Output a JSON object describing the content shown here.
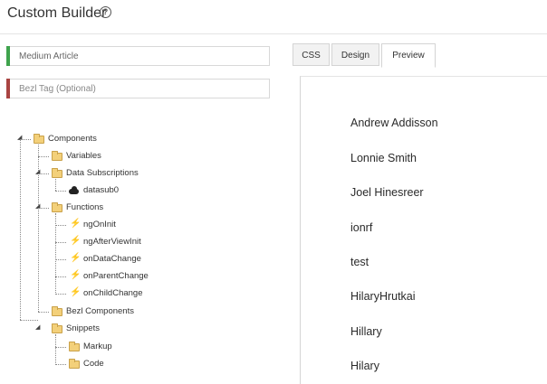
{
  "header": {
    "title": "Custom Builder",
    "help_icon": "?"
  },
  "fields": {
    "name_value": "Medium Article",
    "tag_placeholder": "Bezl Tag (Optional)"
  },
  "tabs": [
    {
      "label": "CSS",
      "active": false
    },
    {
      "label": "Design",
      "active": false
    },
    {
      "label": "Preview",
      "active": true
    }
  ],
  "tree": {
    "root": "Components",
    "variables": "Variables",
    "data_subscriptions": "Data Subscriptions",
    "datasub": "datasub0",
    "functions": "Functions",
    "function_items": [
      "ngOnInit",
      "ngAfterViewInit",
      "onDataChange",
      "onParentChange",
      "onChildChange"
    ],
    "bezl_components": "Bezl Components",
    "snippets": "Snippets",
    "markup": "Markup",
    "code": "Code"
  },
  "preview": {
    "items": [
      "Andrew Addisson",
      "Lonnie Smith",
      "Joel Hinesreer",
      "ionrf",
      "test",
      "HilaryHrutkai",
      "Hillary",
      "Hilary"
    ]
  },
  "colors": {
    "name_bar": "#3fa34d",
    "tag_bar": "#a94442",
    "folder": "#f3d07a"
  }
}
